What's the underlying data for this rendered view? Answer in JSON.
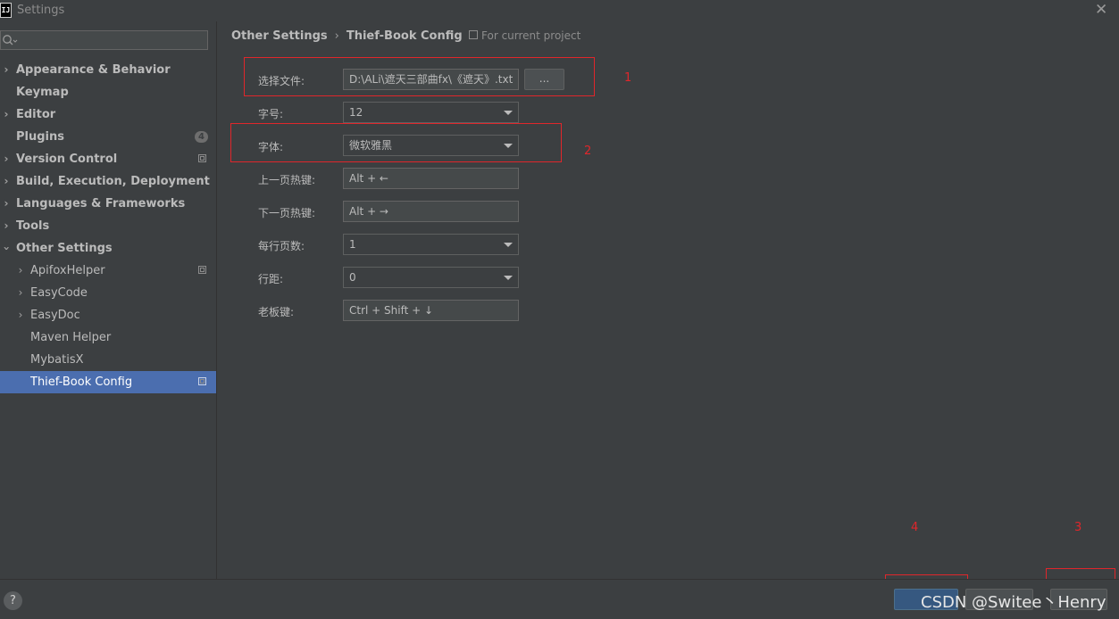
{
  "window": {
    "title": "Settings",
    "app_icon_text": "IJ"
  },
  "sidebar": {
    "search_placeholder": "",
    "items": [
      {
        "label": "Appearance & Behavior",
        "expandable": true
      },
      {
        "label": "Keymap"
      },
      {
        "label": "Editor",
        "expandable": true
      },
      {
        "label": "Plugins",
        "badge": "4"
      },
      {
        "label": "Version Control",
        "expandable": true
      },
      {
        "label": "Build, Execution, Deployment",
        "expandable": true
      },
      {
        "label": "Languages & Frameworks",
        "expandable": true
      },
      {
        "label": "Tools",
        "expandable": true
      },
      {
        "label": "Other Settings",
        "expandable": true,
        "expanded": true
      },
      {
        "label": "ApifoxHelper",
        "expandable": true
      },
      {
        "label": "EasyCode",
        "expandable": true
      },
      {
        "label": "EasyDoc",
        "expandable": true
      },
      {
        "label": "Maven Helper"
      },
      {
        "label": "MybatisX"
      },
      {
        "label": "Thief-Book Config",
        "selected": true
      }
    ]
  },
  "breadcrumb": {
    "parent": "Other Settings",
    "separator": "›",
    "current": "Thief-Book Config"
  },
  "scope_label": "For current project",
  "form": {
    "file_label": "选择文件:",
    "file_value": "D:\\ALi\\遮天三部曲fx\\《遮天》.txt",
    "browse_label": "...",
    "font_size_label": "字号:",
    "font_size_value": "12",
    "font_label": "字体:",
    "font_value": "微软雅黑",
    "prev_hotkey_label": "上一页热键:",
    "prev_hotkey_value": "Alt + ←",
    "next_hotkey_label": "下一页热键:",
    "next_hotkey_value": "Alt + →",
    "pages_per_row_label": "每行页数:",
    "pages_per_row_value": "1",
    "line_spacing_label": "行距:",
    "line_spacing_value": "0",
    "boss_key_label": "老板键:",
    "boss_key_value": "Ctrl + Shift + ↓"
  },
  "annotations": {
    "n1": "1",
    "n2": "2",
    "n3": "3",
    "n4": "4"
  },
  "bottom": {
    "help": "?",
    "watermark": "CSDN @Switee丶Henry"
  },
  "colors": {
    "selection": "#4b6eaf",
    "annotation_red": "#e0262b",
    "ok_button": "#365880"
  }
}
